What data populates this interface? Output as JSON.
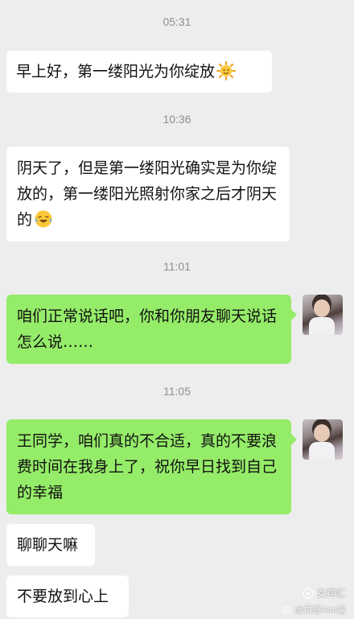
{
  "messages": [
    {
      "time": "05:31",
      "text": "早上好，第一缕阳光为你绽放",
      "emoji": "sun-face-icon"
    },
    {
      "time": "10:36",
      "text": "阴天了，但是第一缕阳光确实是为你绽放的，第一缕阳光照射你家之后才阴天的",
      "emoji": "laugh-cry-icon"
    },
    {
      "time": "11:01",
      "text": "咱们正常说话吧，你和你朋友聊天说话怎么说……"
    },
    {
      "time": "11:05",
      "text": "王同学，咱们真的不合适，真的不要浪费时间在我身上了，祝你早日找到自己的幸福"
    },
    {
      "text": "聊聊天嘛"
    },
    {
      "text": "不要放到心上"
    }
  ],
  "watermark": {
    "brand": "女神汇",
    "handle": "@情感Ann酱"
  },
  "colors": {
    "background": "#ededed",
    "incoming": "#ffffff",
    "outgoing": "#95ec69",
    "timestamp": "#8e8e8e"
  }
}
